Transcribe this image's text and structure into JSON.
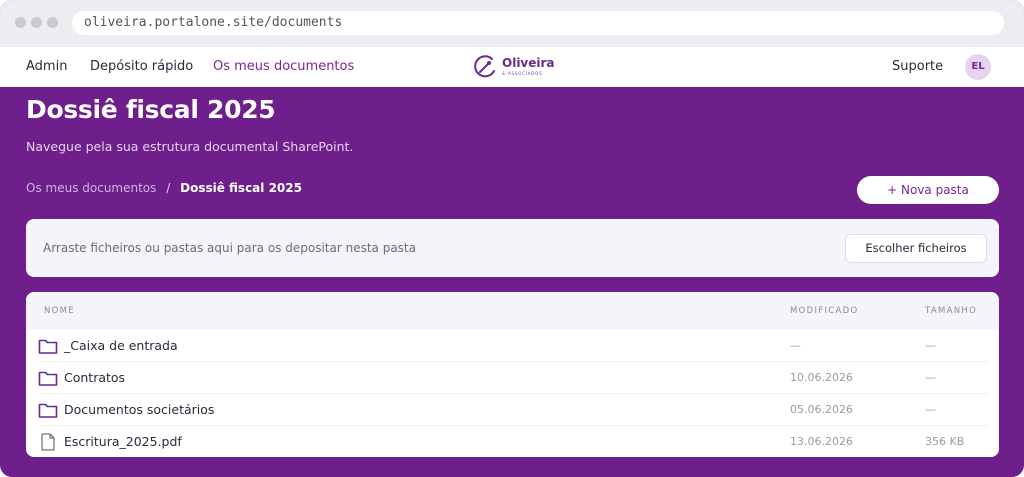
{
  "browser": {
    "url": "oliveira.portalone.site/documents"
  },
  "nav": {
    "links": [
      {
        "label": "Admin",
        "active": false
      },
      {
        "label": "Depósito rápido",
        "active": false
      },
      {
        "label": "Os meus documentos",
        "active": true
      }
    ],
    "logo": {
      "name": "Oliveira",
      "tagline": "& ASSOCIADOS"
    },
    "support_label": "Suporte",
    "avatar_initials": "EL"
  },
  "header": {
    "title": "Dossiê fiscal 2025",
    "subtitle": "Navegue pela sua estrutura documental SharePoint.",
    "breadcrumb": {
      "parent": "Os meus documentos",
      "separator": "/",
      "current": "Dossiê fiscal 2025"
    },
    "new_folder_label": "+ Nova pasta"
  },
  "dropzone": {
    "text": "Arraste ficheiros ou pastas aqui para os depositar nesta pasta",
    "button_label": "Escolher ficheiros"
  },
  "table": {
    "headers": {
      "name": "NOME",
      "modified": "MODIFICADO",
      "size": "TAMANHO"
    },
    "rows": [
      {
        "icon": "folder-icon",
        "name": "_Caixa de entrada",
        "modified": "—",
        "size": "—"
      },
      {
        "icon": "folder-icon",
        "name": "Contratos",
        "modified": "10.06.2026",
        "size": "—"
      },
      {
        "icon": "folder-icon",
        "name": "Documentos societários",
        "modified": "05.06.2026",
        "size": "—"
      },
      {
        "icon": "file-icon",
        "name": "Escritura_2025.pdf",
        "modified": "13.06.2026",
        "size": "356 KB"
      }
    ]
  },
  "colors": {
    "brand": "#6e1f8c",
    "accent": "#7a2596",
    "surface": "#f3f5fa"
  }
}
